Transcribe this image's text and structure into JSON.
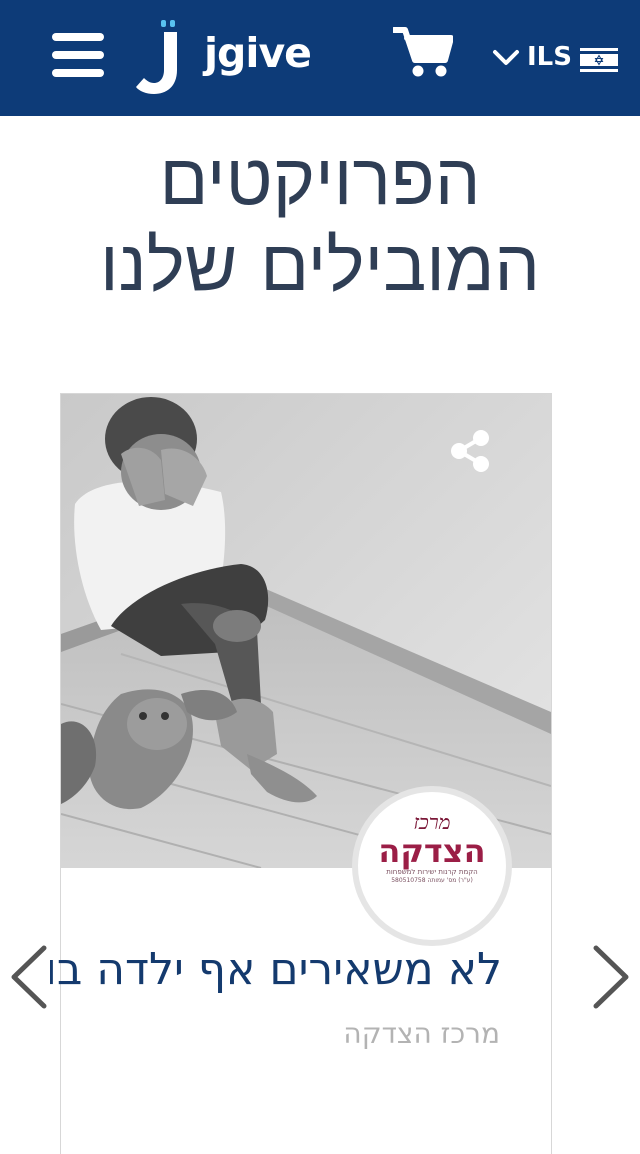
{
  "header": {
    "brand": "jgive",
    "currency": "ILS",
    "icons": {
      "menu": "hamburger-menu-icon",
      "cart": "shopping-cart-icon",
      "dropdown": "chevron-down-icon",
      "flag": "israel-flag-icon"
    },
    "colors": {
      "bar": "#0d3b78",
      "logo_accent": "#59c2f0"
    }
  },
  "main": {
    "title_line1": "הפרויקטים",
    "title_line2": "המובילים שלנו"
  },
  "carousel": {
    "project": {
      "title": "לא משאירים אף ילדה בו",
      "organization": "מרכז הצדקה",
      "image": "child-sitting-in-corner-photo",
      "share_icon": "share-icon"
    },
    "org_logo": {
      "top": "מרכז",
      "main": "הצדקה",
      "sub": "הקמת קרנות ישירות למשפחות",
      "reg": "(ע\"ר) מס' עמותה 580510758"
    },
    "arrows": {
      "prev": "chevron-left-icon",
      "next": "chevron-right-icon"
    },
    "colors": {
      "title": "#143a6e",
      "organization": "#b3b3b3",
      "org_logo_text": "#9b1e46"
    }
  }
}
